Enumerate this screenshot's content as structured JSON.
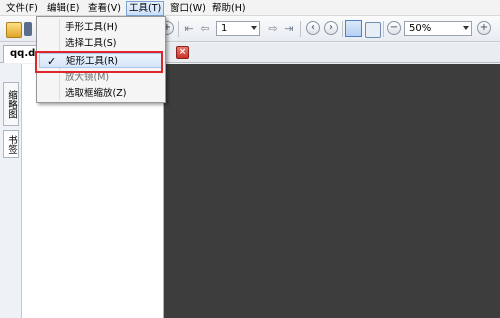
{
  "menubar": {
    "items": [
      {
        "label": "文件(F)"
      },
      {
        "label": "编辑(E)"
      },
      {
        "label": "查看(V)"
      },
      {
        "label": "工具(T)"
      },
      {
        "label": "窗口(W)"
      },
      {
        "label": "帮助(H)"
      }
    ]
  },
  "toolbar": {
    "page_number": "1",
    "zoom": "50%",
    "icons": [
      "open-icon",
      "save-icon",
      "zoom-in-icon",
      "first-page-icon",
      "prev-page-icon",
      "next-page-icon",
      "last-page-icon",
      "back-icon",
      "forward-icon",
      "select-icon",
      "hand-icon",
      "zoom-out-icon",
      "zoom-in-icon"
    ]
  },
  "tabs": {
    "document_tab": "qq.dj",
    "close_symbol": "×"
  },
  "side_panel": {
    "tab_thumbnails": "缩略图",
    "tab_bookmarks": "书签"
  },
  "tools_menu": {
    "items": [
      {
        "label": "手形工具(H)",
        "checked": false
      },
      {
        "label": "选择工具(S)",
        "checked": false
      },
      {
        "label": "矩形工具(R)",
        "checked": true,
        "check_mark": "✓"
      },
      {
        "label": "放大镜(M)",
        "checked": false
      },
      {
        "label": "选取框缩放(Z)",
        "checked": false
      }
    ]
  },
  "colors": {
    "highlight_box": "#e0262b",
    "document_background": "#3d3d3d"
  }
}
